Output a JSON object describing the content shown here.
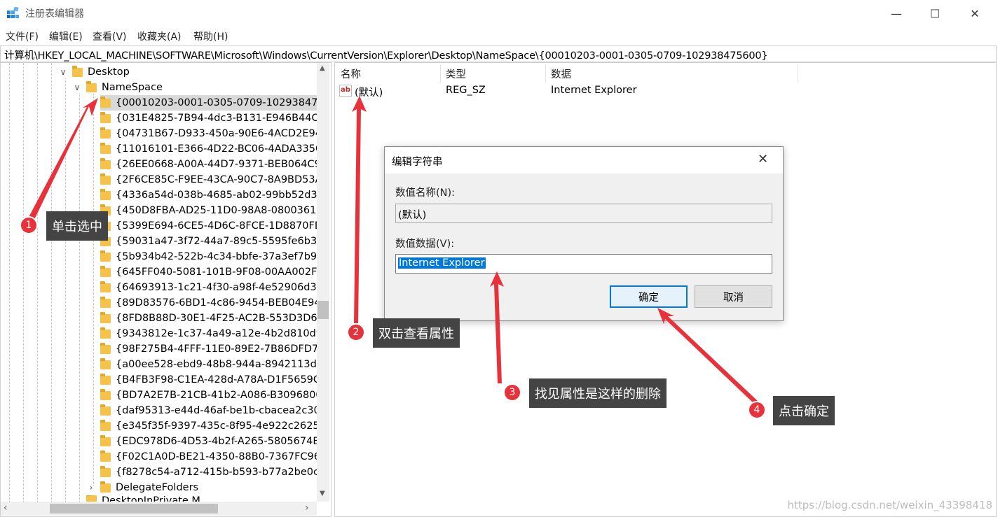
{
  "window": {
    "title": "注册表编辑器",
    "minimize": "—",
    "maximize": "☐",
    "close": "✕"
  },
  "menu": [
    "文件(F)",
    "编辑(E)",
    "查看(V)",
    "收藏夹(A)",
    "帮助(H)"
  ],
  "address": "计算机\\HKEY_LOCAL_MACHINE\\SOFTWARE\\Microsoft\\Windows\\CurrentVersion\\Explorer\\Desktop\\NameSpace\\{00010203-0001-0305-0709-102938475600}",
  "tree": {
    "desktop": "Desktop",
    "namespace": "NameSpace",
    "children": [
      "{00010203-0001-0305-0709-10293847",
      "{031E4825-7B94-4dc3-B131-E946B44C8",
      "{04731B67-D933-450a-90E6-4ACD2E94",
      "{11016101-E366-4D22-BC06-4ADA335C",
      "{26EE0668-A00A-44D7-9371-BEB064C9",
      "{2F6CE85C-F9EE-43CA-90C7-8A9BD53A",
      "{4336a54d-038b-4685-ab02-99bb52d3",
      "{450D8FBA-AD25-11D0-98A8-0800361",
      "{5399E694-6CE5-4D6C-8FCE-1D8870FD",
      "{59031a47-3f72-44a7-89c5-5595fe6b30",
      "{5b934b42-522b-4c34-bbfe-37a3ef7b9",
      "{645FF040-5081-101B-9F08-00AA002F9",
      "{64693913-1c21-4f30-a98f-4e52906d3b",
      "{89D83576-6BD1-4c86-9454-BEB04E94C",
      "{8FD8B88D-30E1-4F25-AC2B-553D3D65",
      "{9343812e-1c37-4a49-a12e-4b2d810d9",
      "{98F275B4-4FFF-11E0-89E2-7B86DFD72",
      "{a00ee528-ebd9-48b8-944a-8942113d4",
      "{B4FB3F98-C1EA-428d-A78A-D1F5659C",
      "{BD7A2E7B-21CB-41b2-A086-B3096800",
      "{daf95313-e44d-46af-be1b-cbacea2c30",
      "{e345f35f-9397-435c-8f95-4e922c2625",
      "{EDC978D6-4D53-4b2f-A265-5805674B",
      "{F02C1A0D-BE21-4350-88B0-7367FC96",
      "{f8278c54-a712-415b-b593-b77a2be0c"
    ],
    "delegate": "DelegateFolders",
    "partial_next": "DesktopInPrivate.M"
  },
  "list": {
    "headers": {
      "name": "名称",
      "type": "类型",
      "data": "数据"
    },
    "row": {
      "name": "(默认)",
      "type": "REG_SZ",
      "data": "Internet Explorer",
      "icon_text": "ab"
    }
  },
  "dialog": {
    "title": "编辑字符串",
    "name_label": "数值名称(N):",
    "name_value": "(默认)",
    "data_label": "数值数据(V):",
    "data_value": "Internet Explorer",
    "ok": "确定",
    "cancel": "取消"
  },
  "annotations": [
    {
      "num": "1",
      "text": "单击选中"
    },
    {
      "num": "2",
      "text": "双击查看属性"
    },
    {
      "num": "3",
      "text": "找见属性是这样的删除"
    },
    {
      "num": "4",
      "text": "点击确定"
    }
  ],
  "watermark": "https://blog.csdn.net/weixin_43398418",
  "colors": {
    "annotation_red": "#e8323b",
    "callout_bg": "#444444",
    "selection": "#0078d7"
  }
}
